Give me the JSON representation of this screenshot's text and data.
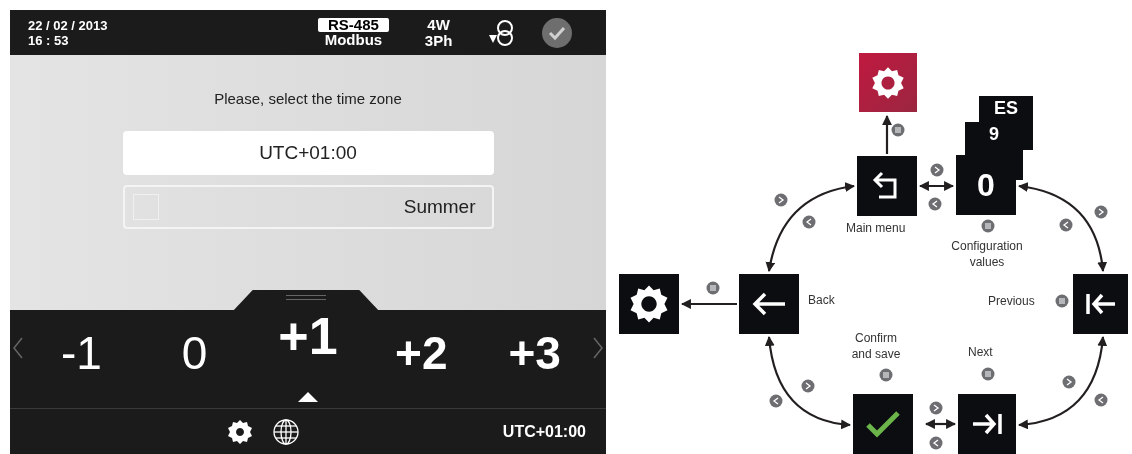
{
  "device": {
    "header": {
      "date": "22 / 02 / 2013",
      "time": "16 : 53",
      "bus": "RS-485",
      "protocol": "Modbus",
      "wiring": "4W",
      "phases": "3Ph"
    },
    "prompt": "Please, select the time zone",
    "timezone_field": {
      "value": "UTC+01:00"
    },
    "summer": {
      "label": "Summer",
      "checked": false
    },
    "offsets": [
      {
        "label": "-1",
        "selected": false,
        "bold": false
      },
      {
        "label": "0",
        "selected": false,
        "bold": false
      },
      {
        "label": "+1",
        "selected": true,
        "bold": true
      },
      {
        "label": "+2",
        "selected": false,
        "bold": true
      },
      {
        "label": "+3",
        "selected": false,
        "bold": true
      }
    ],
    "footer": {
      "timezone": "UTC+01:00"
    }
  },
  "diagram": {
    "config_stack": [
      "ES",
      "9",
      "0"
    ],
    "labels": {
      "main_menu": "Main menu",
      "configuration_values": "Configuration values",
      "back": "Back",
      "previous": "Previous",
      "confirm_and_save": "Confirm and save",
      "next": "Next"
    }
  }
}
